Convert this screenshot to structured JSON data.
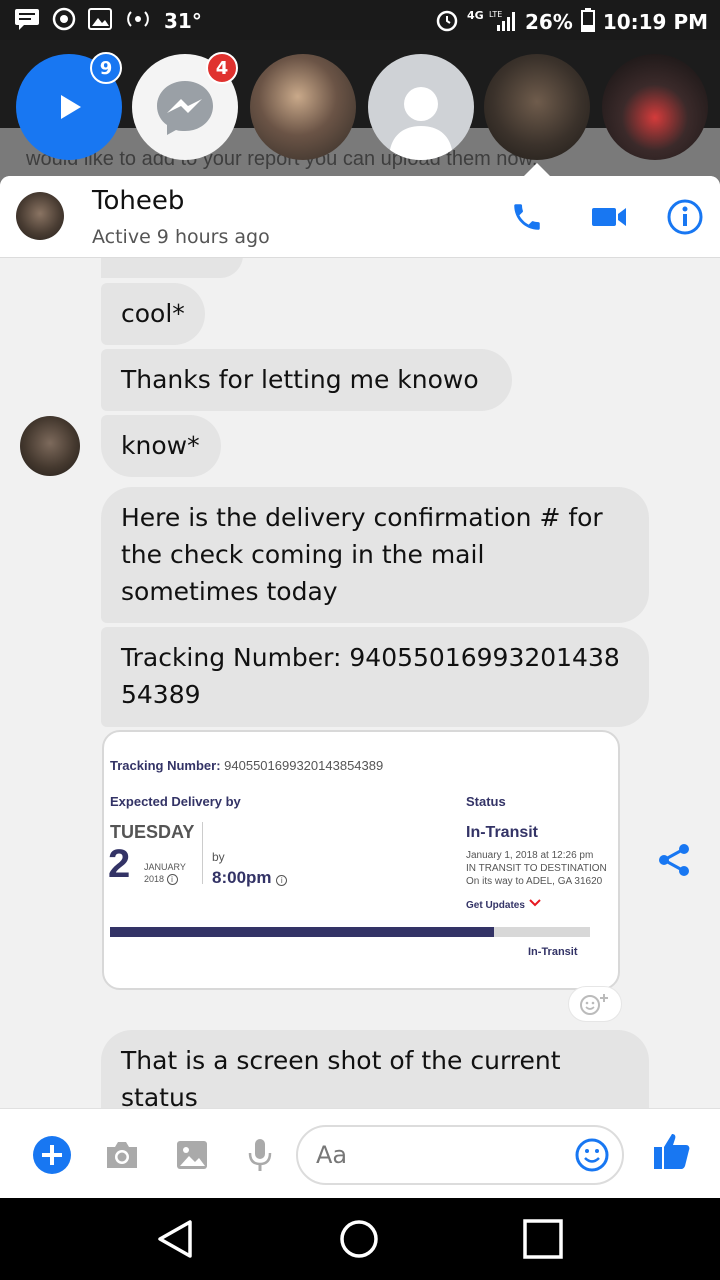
{
  "status_bar": {
    "temperature": "31°",
    "network": "4G LTE",
    "battery": "26%",
    "time": "10:19 PM"
  },
  "chat_heads": {
    "blue_badge": "9",
    "messenger_badge": "4"
  },
  "background_page": {
    "text": "would like to add to your report you can upload them now."
  },
  "header": {
    "name": "Toheeb",
    "status": "Active 9 hours ago"
  },
  "messages": [
    {
      "text": "cool*"
    },
    {
      "text": "Thanks for letting me knowo"
    },
    {
      "text": "know*"
    },
    {
      "text": "Here is the delivery confirmation # for the check coming in the mail sometimes today"
    },
    {
      "text": "Tracking Number: 9405501699320143854389"
    },
    {
      "text": "That is a screen shot of the current status"
    }
  ],
  "tracking_card": {
    "tracking_label": "Tracking Number:",
    "tracking_value": "9405501699320143854389",
    "expected_label": "Expected Delivery by",
    "day": "TUESDAY",
    "date": "2",
    "month": "JANUARY",
    "year": "2018",
    "by_label": "by",
    "time": "8:00pm",
    "status_label": "Status",
    "status_value": "In-Transit",
    "status_detail_1": "January 1, 2018 at 12:26 pm",
    "status_detail_2": "IN TRANSIT TO DESTINATION",
    "status_detail_3": "On its way to ADEL, GA 31620",
    "get_updates": "Get Updates",
    "progress_label": "In-Transit"
  },
  "composer": {
    "placeholder": "Aa"
  },
  "colors": {
    "messenger_blue": "#1877f2",
    "badge_red": "#e0322f",
    "usps_navy": "#333366"
  }
}
